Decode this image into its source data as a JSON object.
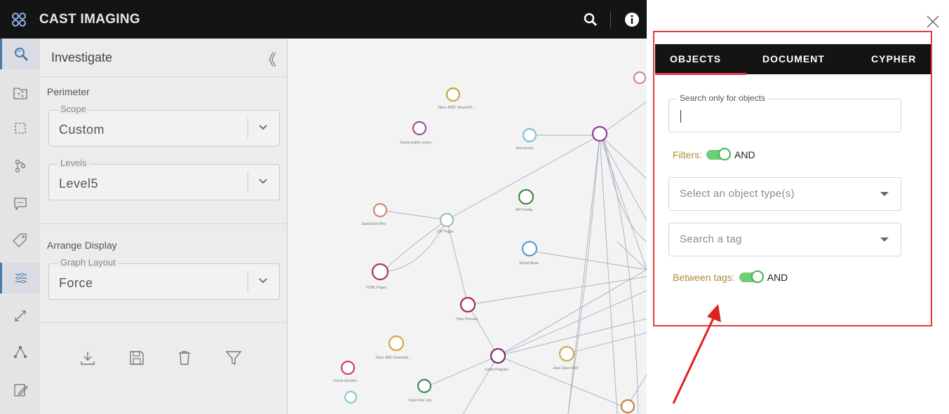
{
  "app": {
    "title": "CAST IMAGING"
  },
  "panel": {
    "title": "Investigate",
    "perimeter_label": "Perimeter",
    "scope": {
      "legend": "Scope",
      "value": "Custom"
    },
    "levels": {
      "legend": "Levels",
      "value": "Level5"
    },
    "arrange_label": "Arrange Display",
    "graph_layout": {
      "legend": "Graph Layout",
      "value": "Force"
    }
  },
  "sidebar_icons": [
    "investigate-icon",
    "folder-share-icon",
    "selection-icon",
    "workflow-icon",
    "comment-icon",
    "tag-icon",
    "settings-sliders-icon",
    "expand-icon",
    "graph-icon",
    "edit-icon"
  ],
  "graph": {
    "labels": [
      "Tibco JDBC Shared R...",
      "Oracle public synon...",
      "Java Enum",
      "JavaScript Files",
      "JSP Pages",
      "API Config",
      "Spring Bean",
      "HTML Pages",
      "Tibco Process",
      "Tibco JMS Connectio...",
      "Java Class DAO",
      "Oracle function",
      "Cobol File Link",
      "Cobol Program"
    ]
  },
  "modal": {
    "tabs": [
      "OBJECTS",
      "DOCUMENT",
      "CYPHER"
    ],
    "active_tab": "OBJECTS",
    "search": {
      "legend": "Search only for objects",
      "value": ""
    },
    "filters_label": "Filters:",
    "filters_mode": "AND",
    "object_type_placeholder": "Select an object type(s)",
    "tag_placeholder": "Search a tag",
    "between_tags_label": "Between tags:",
    "between_tags_mode": "AND"
  },
  "colors": {
    "accent_red": "#e23b3b",
    "tab_underline": "#d63a4a",
    "toggle_green": "#6fcf78",
    "filter_label": "#b08a3e"
  }
}
